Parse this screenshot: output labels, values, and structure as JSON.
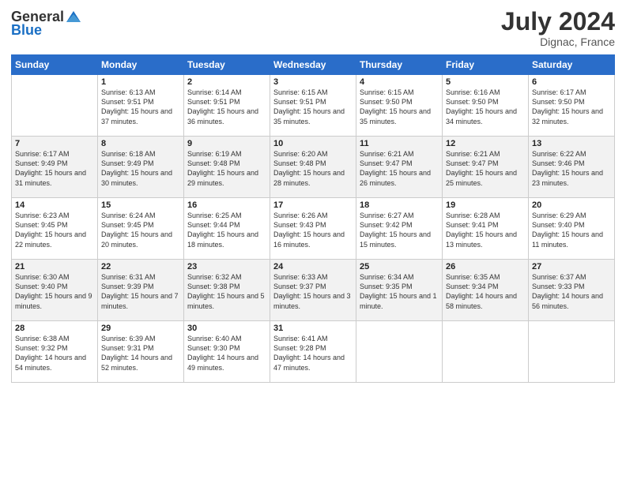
{
  "header": {
    "logo_general": "General",
    "logo_blue": "Blue",
    "month_year": "July 2024",
    "location": "Dignac, France"
  },
  "weekdays": [
    "Sunday",
    "Monday",
    "Tuesday",
    "Wednesday",
    "Thursday",
    "Friday",
    "Saturday"
  ],
  "weeks": [
    [
      {
        "day": "",
        "sunrise": "",
        "sunset": "",
        "daylight": ""
      },
      {
        "day": "1",
        "sunrise": "Sunrise: 6:13 AM",
        "sunset": "Sunset: 9:51 PM",
        "daylight": "Daylight: 15 hours and 37 minutes."
      },
      {
        "day": "2",
        "sunrise": "Sunrise: 6:14 AM",
        "sunset": "Sunset: 9:51 PM",
        "daylight": "Daylight: 15 hours and 36 minutes."
      },
      {
        "day": "3",
        "sunrise": "Sunrise: 6:15 AM",
        "sunset": "Sunset: 9:51 PM",
        "daylight": "Daylight: 15 hours and 35 minutes."
      },
      {
        "day": "4",
        "sunrise": "Sunrise: 6:15 AM",
        "sunset": "Sunset: 9:50 PM",
        "daylight": "Daylight: 15 hours and 35 minutes."
      },
      {
        "day": "5",
        "sunrise": "Sunrise: 6:16 AM",
        "sunset": "Sunset: 9:50 PM",
        "daylight": "Daylight: 15 hours and 34 minutes."
      },
      {
        "day": "6",
        "sunrise": "Sunrise: 6:17 AM",
        "sunset": "Sunset: 9:50 PM",
        "daylight": "Daylight: 15 hours and 32 minutes."
      }
    ],
    [
      {
        "day": "7",
        "sunrise": "Sunrise: 6:17 AM",
        "sunset": "Sunset: 9:49 PM",
        "daylight": "Daylight: 15 hours and 31 minutes."
      },
      {
        "day": "8",
        "sunrise": "Sunrise: 6:18 AM",
        "sunset": "Sunset: 9:49 PM",
        "daylight": "Daylight: 15 hours and 30 minutes."
      },
      {
        "day": "9",
        "sunrise": "Sunrise: 6:19 AM",
        "sunset": "Sunset: 9:48 PM",
        "daylight": "Daylight: 15 hours and 29 minutes."
      },
      {
        "day": "10",
        "sunrise": "Sunrise: 6:20 AM",
        "sunset": "Sunset: 9:48 PM",
        "daylight": "Daylight: 15 hours and 28 minutes."
      },
      {
        "day": "11",
        "sunrise": "Sunrise: 6:21 AM",
        "sunset": "Sunset: 9:47 PM",
        "daylight": "Daylight: 15 hours and 26 minutes."
      },
      {
        "day": "12",
        "sunrise": "Sunrise: 6:21 AM",
        "sunset": "Sunset: 9:47 PM",
        "daylight": "Daylight: 15 hours and 25 minutes."
      },
      {
        "day": "13",
        "sunrise": "Sunrise: 6:22 AM",
        "sunset": "Sunset: 9:46 PM",
        "daylight": "Daylight: 15 hours and 23 minutes."
      }
    ],
    [
      {
        "day": "14",
        "sunrise": "Sunrise: 6:23 AM",
        "sunset": "Sunset: 9:45 PM",
        "daylight": "Daylight: 15 hours and 22 minutes."
      },
      {
        "day": "15",
        "sunrise": "Sunrise: 6:24 AM",
        "sunset": "Sunset: 9:45 PM",
        "daylight": "Daylight: 15 hours and 20 minutes."
      },
      {
        "day": "16",
        "sunrise": "Sunrise: 6:25 AM",
        "sunset": "Sunset: 9:44 PM",
        "daylight": "Daylight: 15 hours and 18 minutes."
      },
      {
        "day": "17",
        "sunrise": "Sunrise: 6:26 AM",
        "sunset": "Sunset: 9:43 PM",
        "daylight": "Daylight: 15 hours and 16 minutes."
      },
      {
        "day": "18",
        "sunrise": "Sunrise: 6:27 AM",
        "sunset": "Sunset: 9:42 PM",
        "daylight": "Daylight: 15 hours and 15 minutes."
      },
      {
        "day": "19",
        "sunrise": "Sunrise: 6:28 AM",
        "sunset": "Sunset: 9:41 PM",
        "daylight": "Daylight: 15 hours and 13 minutes."
      },
      {
        "day": "20",
        "sunrise": "Sunrise: 6:29 AM",
        "sunset": "Sunset: 9:40 PM",
        "daylight": "Daylight: 15 hours and 11 minutes."
      }
    ],
    [
      {
        "day": "21",
        "sunrise": "Sunrise: 6:30 AM",
        "sunset": "Sunset: 9:40 PM",
        "daylight": "Daylight: 15 hours and 9 minutes."
      },
      {
        "day": "22",
        "sunrise": "Sunrise: 6:31 AM",
        "sunset": "Sunset: 9:39 PM",
        "daylight": "Daylight: 15 hours and 7 minutes."
      },
      {
        "day": "23",
        "sunrise": "Sunrise: 6:32 AM",
        "sunset": "Sunset: 9:38 PM",
        "daylight": "Daylight: 15 hours and 5 minutes."
      },
      {
        "day": "24",
        "sunrise": "Sunrise: 6:33 AM",
        "sunset": "Sunset: 9:37 PM",
        "daylight": "Daylight: 15 hours and 3 minutes."
      },
      {
        "day": "25",
        "sunrise": "Sunrise: 6:34 AM",
        "sunset": "Sunset: 9:35 PM",
        "daylight": "Daylight: 15 hours and 1 minute."
      },
      {
        "day": "26",
        "sunrise": "Sunrise: 6:35 AM",
        "sunset": "Sunset: 9:34 PM",
        "daylight": "Daylight: 14 hours and 58 minutes."
      },
      {
        "day": "27",
        "sunrise": "Sunrise: 6:37 AM",
        "sunset": "Sunset: 9:33 PM",
        "daylight": "Daylight: 14 hours and 56 minutes."
      }
    ],
    [
      {
        "day": "28",
        "sunrise": "Sunrise: 6:38 AM",
        "sunset": "Sunset: 9:32 PM",
        "daylight": "Daylight: 14 hours and 54 minutes."
      },
      {
        "day": "29",
        "sunrise": "Sunrise: 6:39 AM",
        "sunset": "Sunset: 9:31 PM",
        "daylight": "Daylight: 14 hours and 52 minutes."
      },
      {
        "day": "30",
        "sunrise": "Sunrise: 6:40 AM",
        "sunset": "Sunset: 9:30 PM",
        "daylight": "Daylight: 14 hours and 49 minutes."
      },
      {
        "day": "31",
        "sunrise": "Sunrise: 6:41 AM",
        "sunset": "Sunset: 9:28 PM",
        "daylight": "Daylight: 14 hours and 47 minutes."
      },
      {
        "day": "",
        "sunrise": "",
        "sunset": "",
        "daylight": ""
      },
      {
        "day": "",
        "sunrise": "",
        "sunset": "",
        "daylight": ""
      },
      {
        "day": "",
        "sunrise": "",
        "sunset": "",
        "daylight": ""
      }
    ]
  ]
}
